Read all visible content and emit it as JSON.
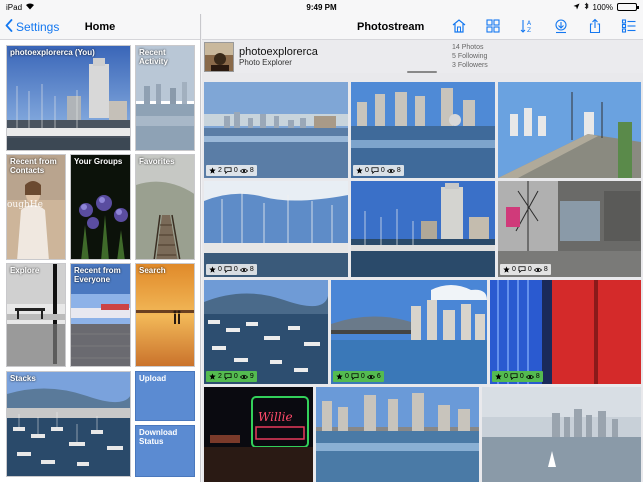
{
  "status_bar": {
    "device": "iPad",
    "time": "9:49 PM",
    "battery": "100%",
    "battery_level": 1.0
  },
  "left_panel": {
    "back_label": "Settings",
    "title": "Home",
    "tiles": {
      "profile": "photoexplorerca (You)",
      "recent_activity": "Recent Activity",
      "recent_contacts": "Recent from Contacts",
      "groups": "Your Groups",
      "favorites": "Favorites",
      "explore": "Explore",
      "recent_everyone": "Recent from Everyone",
      "search": "Search",
      "stacks": "Stacks",
      "upload": "Upload",
      "download_status": "Download Status"
    }
  },
  "right_panel": {
    "title": "Photostream",
    "toolbar": [
      "home-icon",
      "grid-icon",
      "sort-az-icon",
      "download-icon",
      "share-icon",
      "list-icon"
    ],
    "profile": {
      "username": "photoexplorerca",
      "subtitle": "Photo Explorer",
      "photos": "14 Photos",
      "following": "5 Following",
      "followers": "3 Followers"
    },
    "photos": [
      {
        "favs": "2",
        "comments": "0",
        "views": "8",
        "highlight": false
      },
      {
        "favs": "0",
        "comments": "0",
        "views": "8",
        "highlight": false
      },
      {
        "favs": "",
        "comments": "",
        "views": "",
        "highlight": false
      },
      {
        "favs": "0",
        "comments": "0",
        "views": "8",
        "highlight": false
      },
      {
        "favs": "",
        "comments": "",
        "views": "",
        "highlight": false
      },
      {
        "favs": "0",
        "comments": "0",
        "views": "8",
        "highlight": false
      },
      {
        "favs": "2",
        "comments": "0",
        "views": "9",
        "highlight": true
      },
      {
        "favs": "0",
        "comments": "0",
        "views": "6",
        "highlight": true
      },
      {
        "favs": "0",
        "comments": "0",
        "views": "8",
        "highlight": true
      }
    ]
  }
}
